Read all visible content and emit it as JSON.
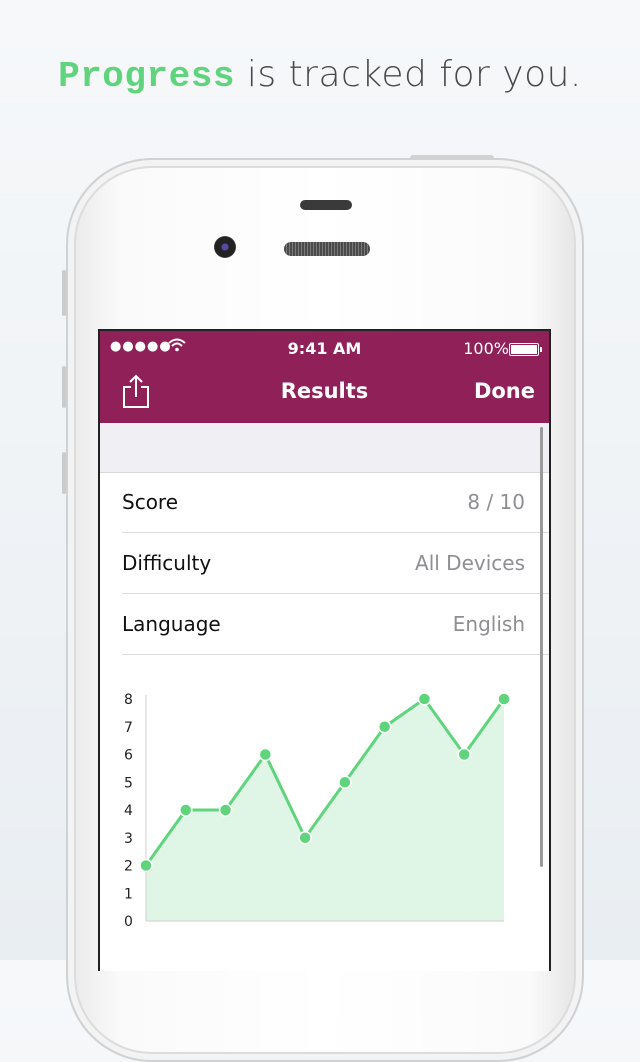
{
  "headline": {
    "accent": "Progress",
    "rest": " is tracked for you."
  },
  "status_bar": {
    "signal": "●●●●●",
    "time": "9:41 AM",
    "battery": "100%"
  },
  "nav": {
    "title": "Results",
    "done": "Done"
  },
  "rows": [
    {
      "label": "Score",
      "value": "8 / 10"
    },
    {
      "label": "Difficulty",
      "value": "All Devices"
    },
    {
      "label": "Language",
      "value": "English"
    }
  ],
  "colors": {
    "nav_bg": "#8f2158",
    "accent_green": "#5fd47c",
    "area_fill": "#dff6e6"
  },
  "chart_data": {
    "type": "area",
    "x": [
      1,
      2,
      3,
      4,
      5,
      6,
      7,
      8,
      9,
      10
    ],
    "values": [
      2,
      4,
      4,
      6,
      3,
      5,
      7,
      8,
      6,
      8
    ],
    "yticks": [
      "0",
      "1",
      "2",
      "3",
      "4",
      "5",
      "6",
      "7",
      "8"
    ],
    "ylim": [
      0,
      8
    ],
    "grid": false,
    "title": "",
    "xlabel": "",
    "ylabel": ""
  }
}
